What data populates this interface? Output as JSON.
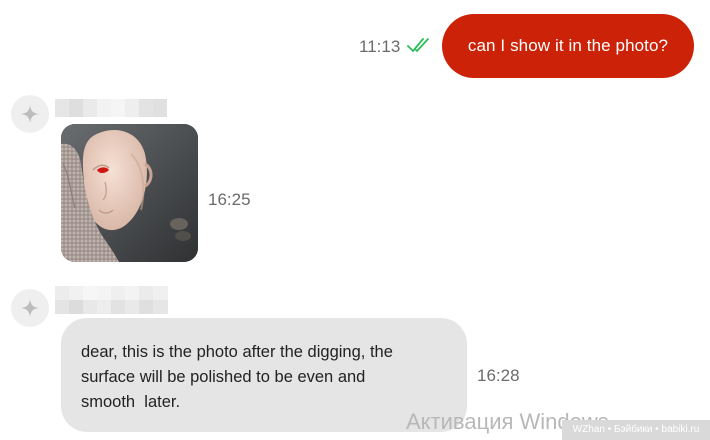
{
  "outgoing_message": {
    "text": "can I show it in the photo?",
    "time": "11:13",
    "status_icon": "double-check-icon",
    "bubble_color": "#cc2208",
    "check_color": "#2ebd59"
  },
  "incoming_photo_message": {
    "time": "16:25",
    "avatar_icon": "sparkle-icon"
  },
  "incoming_text_message": {
    "lines": [
      "dear, this is the photo after the digging, the",
      "surface will be polished to be even and",
      "smooth  later."
    ],
    "time": "16:28",
    "avatar_icon": "sparkle-icon"
  },
  "watermarks": {
    "activation": "Активация Windows",
    "site": "WZhan • Бэйбики • babiki.ru"
  }
}
